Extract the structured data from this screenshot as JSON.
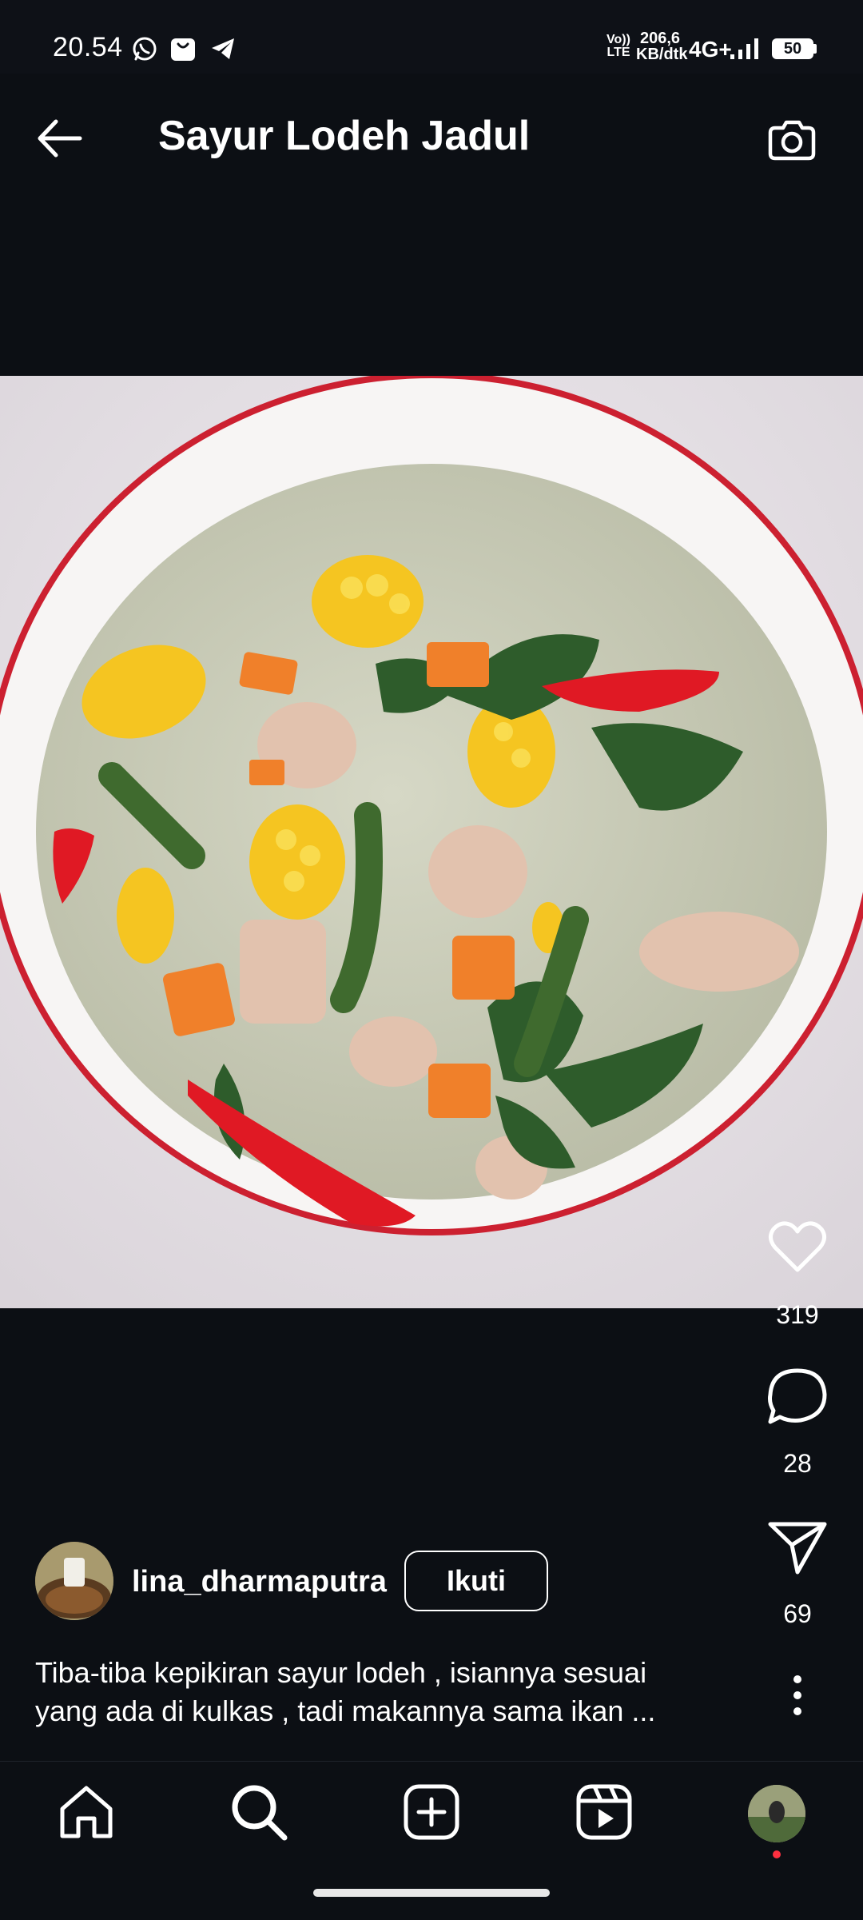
{
  "status_bar": {
    "time": "20.54",
    "network_volte": "Vo)) LTE",
    "speed_value": "206,6",
    "speed_unit": "KB/dtk",
    "network_type": "4G+",
    "battery": "50"
  },
  "header": {
    "title": "Sayur Lodeh Jadul",
    "back_icon": "arrow-left-icon",
    "camera_icon": "camera-icon"
  },
  "post": {
    "image_icon": "food-photo",
    "likes": "319",
    "comments": "28",
    "shares": "69",
    "author": {
      "username": "lina_dharmaputra",
      "follow_label": "Ikuti"
    },
    "caption_line1": "Tiba-tiba kepikiran sayur lodeh , isiannya  sesuai",
    "caption_line2": "yang ada di kulkas , tadi makannya sama ikan ..."
  },
  "bottom_nav": {
    "items": [
      "home-icon",
      "search-icon",
      "create-icon",
      "reels-icon",
      "profile-avatar"
    ]
  },
  "colors": {
    "background": "#0c0f14",
    "text": "#ffffff",
    "notification_dot": "#ff3040"
  }
}
